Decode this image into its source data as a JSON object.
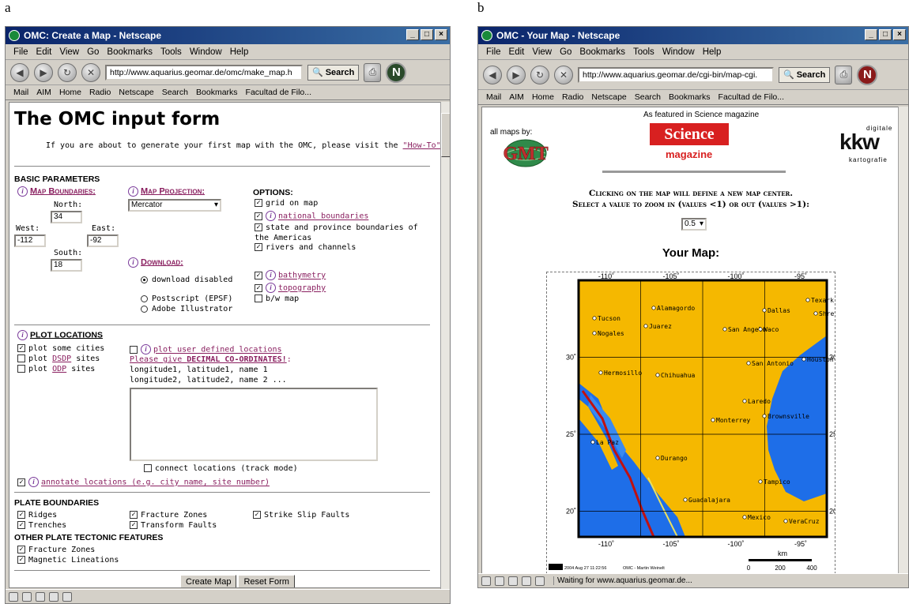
{
  "panels": {
    "a": "a",
    "b": "b"
  },
  "windowA": {
    "title": "OMC: Create a Map - Netscape",
    "menu": [
      "File",
      "Edit",
      "View",
      "Go",
      "Bookmarks",
      "Tools",
      "Window",
      "Help"
    ],
    "url": "http://www.aquarius.geomar.de/omc/make_map.h",
    "search_label": "Search",
    "bookmarks": [
      "Mail",
      "AIM",
      "Home",
      "Radio",
      "Netscape",
      "Search",
      "Bookmarks",
      "Facultad de Filo..."
    ],
    "page": {
      "heading": "The OMC input form",
      "intro_prefix": "If you are about to generate your first map with the OMC, please visit the ",
      "intro_link": "\"How-To\"-page",
      "intro_suffix": ".",
      "basic_parameters": "BASIC PARAMETERS",
      "map_boundaries": "Map Boundaries:",
      "north_label": "North:",
      "north_value": "34",
      "west_label": "West:",
      "west_value": "-112",
      "east_label": "East:",
      "east_value": "-92",
      "south_label": "South:",
      "south_value": "18",
      "map_projection": "Map Projection:",
      "projection_value": "Mercator",
      "options_label": "OPTIONS:",
      "opt_grid": "grid on map",
      "opt_national": "national boundaries",
      "opt_state": "state and province boundaries of the Americas",
      "opt_rivers": "rivers and channels",
      "download_label": "Download:",
      "dl_disabled": "download disabled",
      "dl_postscript": "Postscript (EPSF)",
      "dl_illustrator": "Adobe Illustrator",
      "opt_bathymetry": "bathymetry",
      "opt_topography": "topography",
      "opt_bw": "b/w map",
      "plot_locations": "PLOT LOCATIONS",
      "plot_cities": "plot some cities",
      "plot_dsdp_a": "plot ",
      "plot_dsdp_b": "DSDP",
      "plot_dsdp_c": " sites",
      "plot_odp_a": "plot ",
      "plot_odp_b": "ODP",
      "plot_odp_c": " sites",
      "plot_user": "plot user defined locations",
      "decimal_a": "Please give ",
      "decimal_b": "DECIMAL CO-ORDINATES!",
      "decimal_c": ":",
      "coords_line1": "longitude1, latitude1, name 1",
      "coords_line2": "longitude2, latitude2, name 2 ...",
      "connect": "connect locations (track mode)",
      "annotate": "annotate locations (e.g. city name, site number)",
      "plate_boundaries": "PLATE BOUNDARIES",
      "ridges": "Ridges",
      "trenches": "Trenches",
      "fracture_zones": "Fracture Zones",
      "transform_faults": "Transform Faults",
      "strike_slip": "Strike Slip Faults",
      "other_features": "OTHER PLATE TECTONIC FEATURES",
      "fracture_zones2": "Fracture Zones",
      "magnetic": "Magnetic Lineations",
      "create_map": "Create Map",
      "reset_form": "Reset Form"
    }
  },
  "windowB": {
    "title": "OMC - Your Map - Netscape",
    "menu": [
      "File",
      "Edit",
      "View",
      "Go",
      "Bookmarks",
      "Tools",
      "Window",
      "Help"
    ],
    "url": "http://www.aquarius.geomar.de/cgi-bin/map-cgi.",
    "search_label": "Search",
    "bookmarks": [
      "Mail",
      "AIM",
      "Home",
      "Radio",
      "Netscape",
      "Search",
      "Bookmarks",
      "Facultad de Filo..."
    ],
    "page": {
      "featured": "As featured in Science magazine",
      "all_maps_by": "all maps by:",
      "gmt_logo": "GMT",
      "science": "Science",
      "magazine": "magazine",
      "kkw": "kkw",
      "kkw_top": "digitale",
      "kkw_bottom": "kartografie",
      "instr1": "Clicking on the map will define a new map center.",
      "instr2": "Select a value to zoom in (values <1) or out (values >1):",
      "zoom_value": "0.5",
      "your_map": "Your Map:",
      "lon_labels": [
        "-110˚",
        "-105˚",
        "-100˚",
        "-95˚"
      ],
      "lat_labels": [
        "30˚",
        "25˚",
        "20˚"
      ],
      "cities": [
        "Alamagordo",
        "Tucson",
        "Nogales",
        "Juarez",
        "San Angelo",
        "Waco",
        "Dallas",
        "Texark",
        "Shrev",
        "Hermosillo",
        "Chihuahua",
        "San Antonio",
        "Houston",
        "Laredo",
        "Monterrey",
        "Brownsville",
        "Durango",
        "Tampico",
        "Guadalajara",
        "Mexico",
        "VeraCruz",
        "La Paz"
      ],
      "km_label": "km",
      "scale_ticks": [
        "0",
        "200",
        "400"
      ],
      "gmt_stamp": "2004 Aug 27 11:22:56",
      "credit": "OMC - Martin Weinelt"
    },
    "status": "Waiting for www.aquarius.geomar.de..."
  }
}
